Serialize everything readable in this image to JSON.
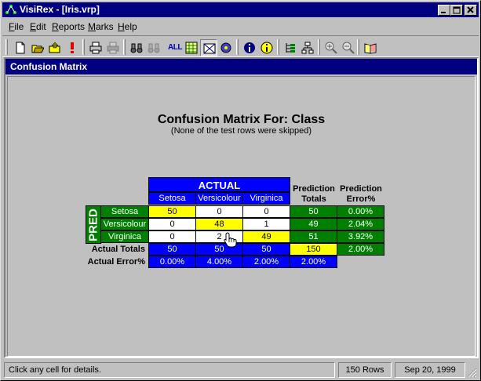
{
  "window": {
    "title": "VisiRex - [Iris.vrp]"
  },
  "menu": [
    {
      "key": "F",
      "rest": "ile"
    },
    {
      "key": "E",
      "rest": "dit"
    },
    {
      "key": "R",
      "rest": "eports"
    },
    {
      "key": "M",
      "rest": "arks"
    },
    {
      "key": "H",
      "rest": "elp"
    }
  ],
  "toolbar": {
    "all_label": "ALL"
  },
  "child_window": {
    "title": "Confusion Matrix"
  },
  "report": {
    "title": "Confusion Matrix For: Class",
    "subtitle": "(None of the test rows were skipped)",
    "actual_header": "ACTUAL",
    "pred_header": "PRED",
    "columns": [
      "Setosa",
      "Versicolour",
      "Virginica"
    ],
    "prediction_totals_header": [
      "Prediction",
      "Totals"
    ],
    "prediction_error_header": [
      "Prediction",
      "Error%"
    ],
    "rows": [
      {
        "label": "Setosa",
        "cells": [
          "50",
          "0",
          "0"
        ],
        "total": "50",
        "error": "0.00%"
      },
      {
        "label": "Versicolour",
        "cells": [
          "0",
          "48",
          "1"
        ],
        "total": "49",
        "error": "2.04%"
      },
      {
        "label": "Virginica",
        "cells": [
          "0",
          "2",
          "49"
        ],
        "total": "51",
        "error": "3.92%"
      }
    ],
    "actual_totals_label": "Actual Totals",
    "actual_totals": [
      "50",
      "50",
      "50"
    ],
    "grand_total": "150",
    "grand_error": "2.00%",
    "actual_error_label": "Actual Error%",
    "actual_errors": [
      "0.00%",
      "4.00%",
      "2.00%"
    ],
    "overall_error": "2.00%"
  },
  "status": {
    "message": "Click any cell for details.",
    "rows": "150 Rows",
    "date": "Sep 20, 1999"
  },
  "colors": {
    "titlebar": "#000080",
    "actual_blue": "#0000ff",
    "pred_green": "#008000",
    "diagonal_yellow": "#ffff00"
  }
}
